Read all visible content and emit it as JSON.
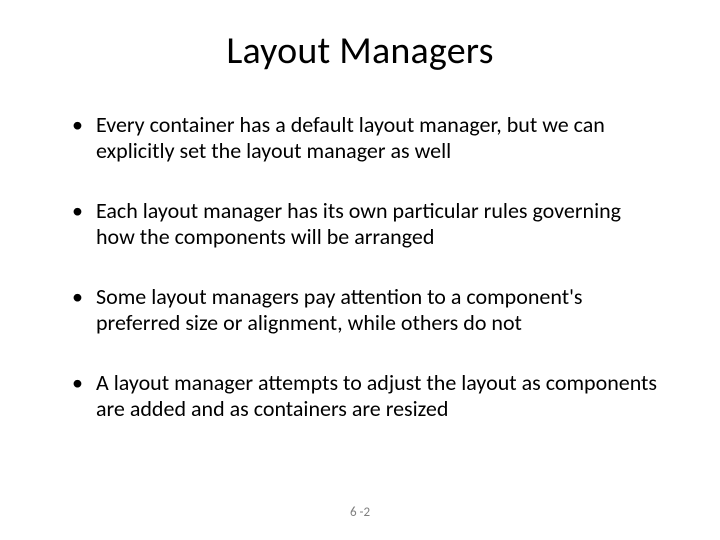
{
  "title": "Layout Managers",
  "bullets": [
    "Every container has a default layout manager, but we can explicitly set the layout manager as well",
    "Each layout manager has its own particular rules governing how the components will be arranged",
    "Some layout managers pay attention to a component's preferred size or alignment, while others do not",
    "A layout manager attempts to adjust the layout as components are added and as containers are resized"
  ],
  "footer": "6 -2"
}
